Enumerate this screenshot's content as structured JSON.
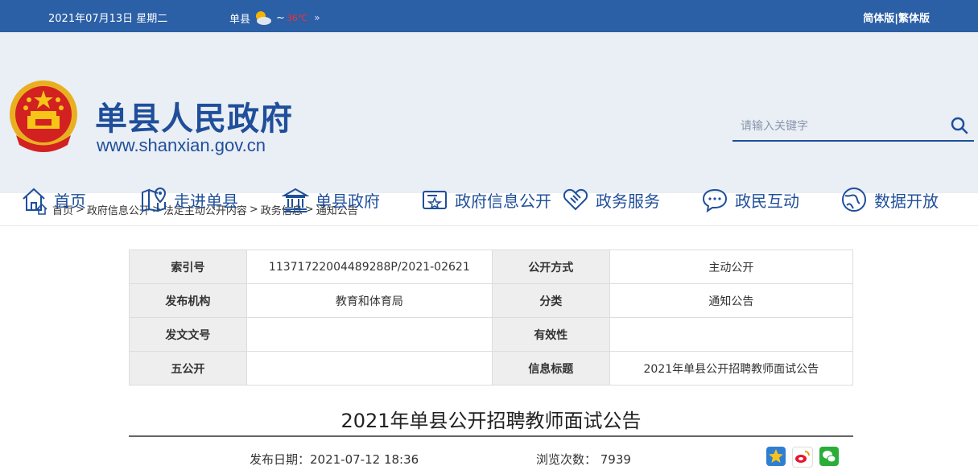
{
  "topbar": {
    "date": "2021年07月13日 星期二",
    "weather_city": "单县",
    "weather_temp_low": "",
    "weather_sep": "~",
    "weather_temp_high": "36℃",
    "weather_more": "»",
    "lang_simplified": "简体版",
    "lang_sep": "|",
    "lang_traditional": "繁体版"
  },
  "header": {
    "title": "单县人民政府",
    "url": "www.shanxian.gov.cn",
    "search_placeholder": "请输入关键字"
  },
  "nav": {
    "items": [
      {
        "label": "首页",
        "icon": "home-icon"
      },
      {
        "label": "走进单县",
        "icon": "map-pin-icon"
      },
      {
        "label": "单县政府",
        "icon": "government-building-icon"
      },
      {
        "label": "政府信息公开",
        "icon": "id-card-icon"
      },
      {
        "label": "政务服务",
        "icon": "handshake-icon"
      },
      {
        "label": "政民互动",
        "icon": "chat-bubble-icon"
      },
      {
        "label": "数据开放",
        "icon": "globe-icon"
      }
    ]
  },
  "breadcrumb": [
    "首页",
    "政府信息公开",
    "法定主动公开内容",
    "政务信息",
    "通知公告"
  ],
  "meta": {
    "rows": [
      {
        "k1": "索引号",
        "v1": "11371722004489288P/2021-02621",
        "k2": "公开方式",
        "v2": "主动公开"
      },
      {
        "k1": "发布机构",
        "v1": "教育和体育局",
        "k2": "分类",
        "v2": "通知公告"
      },
      {
        "k1": "发文文号",
        "v1": "",
        "k2": "有效性",
        "v2": ""
      },
      {
        "k1": "五公开",
        "v1": "",
        "k2": "信息标题",
        "v2": "2021年单县公开招聘教师面试公告"
      }
    ]
  },
  "article": {
    "title": "2021年单县公开招聘教师面试公告",
    "pubdate": "发布日期：2021-07-12 18:36",
    "views": "浏览次数： 7939"
  },
  "colors": {
    "brand": "#2b5fa6",
    "nav_text": "#1f4f9a"
  }
}
